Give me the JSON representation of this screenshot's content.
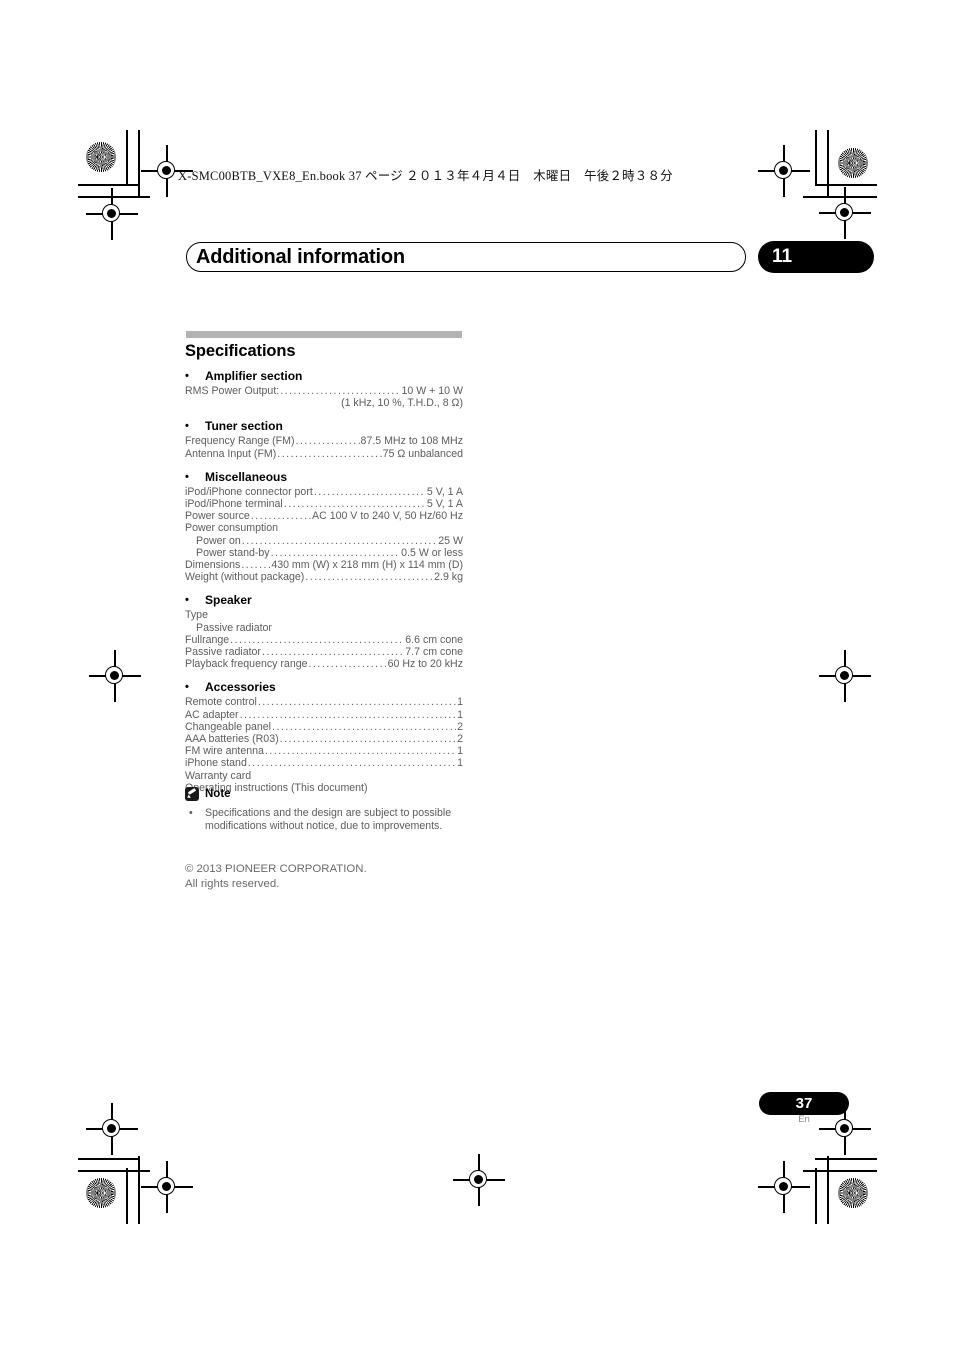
{
  "book_line": "X-SMC00BTB_VXE8_En.book   37 ページ   ２０１３年４月４日　木曜日　午後２時３８分",
  "chapter": {
    "title": "Additional information",
    "number": "11"
  },
  "specifications": {
    "heading": "Specifications",
    "sections": [
      {
        "title": "Amplifier section",
        "rows": [
          {
            "label": "RMS Power Output:",
            "value": "10 W + 10 W",
            "leader": true
          },
          {
            "label": "",
            "value": "(1 kHz, 10 %, T.H.D., 8 Ω)",
            "leader": false,
            "align": "right"
          }
        ]
      },
      {
        "title": "Tuner section",
        "rows": [
          {
            "label": "Frequency Range (FM)",
            "value": "87.5 MHz to 108 MHz",
            "leader": true
          },
          {
            "label": "Antenna Input (FM)",
            "value": "75 Ω unbalanced",
            "leader": true
          }
        ]
      },
      {
        "title": "Miscellaneous",
        "rows": [
          {
            "label": "iPod/iPhone connector port",
            "value": "5 V, 1 A",
            "leader": true
          },
          {
            "label": "iPod/iPhone terminal",
            "value": "5 V, 1 A",
            "leader": true
          },
          {
            "label": "Power source",
            "value": "AC 100 V to 240 V, 50 Hz/60 Hz",
            "leader": true
          },
          {
            "label": "Power consumption",
            "value": "",
            "leader": false
          },
          {
            "label": "Power on",
            "value": "25 W",
            "leader": true,
            "indent": true
          },
          {
            "label": "Power stand-by",
            "value": "0.5 W or less",
            "leader": true,
            "indent": true
          },
          {
            "label": "Dimensions",
            "value": "430 mm (W) x 218 mm (H) x 114 mm (D)",
            "leader": true
          },
          {
            "label": "Weight (without package)",
            "value": "2.9 kg",
            "leader": true
          }
        ]
      },
      {
        "title": "Speaker",
        "rows": [
          {
            "label": "Type",
            "value": "",
            "leader": false
          },
          {
            "label": "Passive radiator",
            "value": "",
            "leader": false,
            "indent": true
          },
          {
            "label": "Fullrange",
            "value": "6.6 cm cone",
            "leader": true
          },
          {
            "label": "Passive radiator",
            "value": "7.7 cm cone",
            "leader": true
          },
          {
            "label": "Playback frequency range",
            "value": "60 Hz to 20 kHz",
            "leader": true
          }
        ]
      },
      {
        "title": "Accessories",
        "rows": [
          {
            "label": "Remote control",
            "value": "1",
            "leader": true
          },
          {
            "label": "AC adapter",
            "value": "1",
            "leader": true
          },
          {
            "label": "Changeable panel",
            "value": "2",
            "leader": true
          },
          {
            "label": "AAA batteries (R03)",
            "value": "2",
            "leader": true
          },
          {
            "label": "FM wire antenna",
            "value": "1",
            "leader": true
          },
          {
            "label": "iPhone stand",
            "value": "1",
            "leader": true
          },
          {
            "label": "Warranty card",
            "value": "",
            "leader": false
          },
          {
            "label": "Operating instructions (This document)",
            "value": "",
            "leader": false
          }
        ]
      }
    ]
  },
  "note": {
    "icon": "note-pencil-icon",
    "title": "Note",
    "bullet": "•",
    "text": "Specifications and the design are subject to possible modifications without notice, due to improvements."
  },
  "copyright": {
    "line1": "© 2013 PIONEER CORPORATION.",
    "line2": "All rights reserved."
  },
  "footer": {
    "page_number": "37",
    "language": "En"
  },
  "colors": {
    "gray_rule": "#b3b3b3",
    "body_text": "#5c5c5c",
    "heading_text": "#000000",
    "chapter_badge": "#000000"
  }
}
